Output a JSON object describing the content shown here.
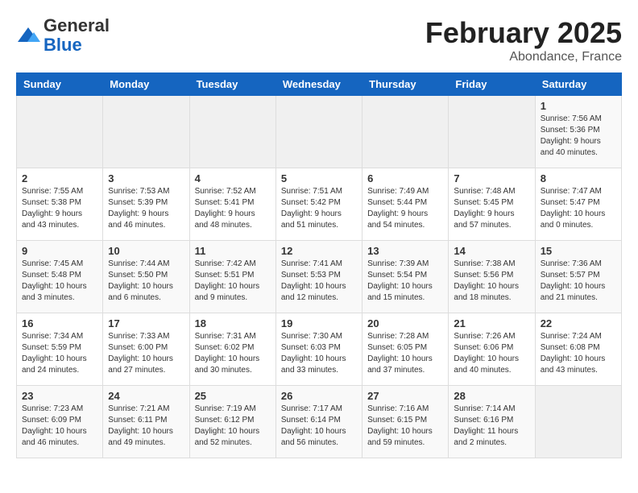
{
  "logo": {
    "general": "General",
    "blue": "Blue"
  },
  "title": "February 2025",
  "location": "Abondance, France",
  "days_of_week": [
    "Sunday",
    "Monday",
    "Tuesday",
    "Wednesday",
    "Thursday",
    "Friday",
    "Saturday"
  ],
  "weeks": [
    [
      {
        "day": "",
        "info": ""
      },
      {
        "day": "",
        "info": ""
      },
      {
        "day": "",
        "info": ""
      },
      {
        "day": "",
        "info": ""
      },
      {
        "day": "",
        "info": ""
      },
      {
        "day": "",
        "info": ""
      },
      {
        "day": "1",
        "info": "Sunrise: 7:56 AM\nSunset: 5:36 PM\nDaylight: 9 hours and 40 minutes."
      }
    ],
    [
      {
        "day": "2",
        "info": "Sunrise: 7:55 AM\nSunset: 5:38 PM\nDaylight: 9 hours and 43 minutes."
      },
      {
        "day": "3",
        "info": "Sunrise: 7:53 AM\nSunset: 5:39 PM\nDaylight: 9 hours and 46 minutes."
      },
      {
        "day": "4",
        "info": "Sunrise: 7:52 AM\nSunset: 5:41 PM\nDaylight: 9 hours and 48 minutes."
      },
      {
        "day": "5",
        "info": "Sunrise: 7:51 AM\nSunset: 5:42 PM\nDaylight: 9 hours and 51 minutes."
      },
      {
        "day": "6",
        "info": "Sunrise: 7:49 AM\nSunset: 5:44 PM\nDaylight: 9 hours and 54 minutes."
      },
      {
        "day": "7",
        "info": "Sunrise: 7:48 AM\nSunset: 5:45 PM\nDaylight: 9 hours and 57 minutes."
      },
      {
        "day": "8",
        "info": "Sunrise: 7:47 AM\nSunset: 5:47 PM\nDaylight: 10 hours and 0 minutes."
      }
    ],
    [
      {
        "day": "9",
        "info": "Sunrise: 7:45 AM\nSunset: 5:48 PM\nDaylight: 10 hours and 3 minutes."
      },
      {
        "day": "10",
        "info": "Sunrise: 7:44 AM\nSunset: 5:50 PM\nDaylight: 10 hours and 6 minutes."
      },
      {
        "day": "11",
        "info": "Sunrise: 7:42 AM\nSunset: 5:51 PM\nDaylight: 10 hours and 9 minutes."
      },
      {
        "day": "12",
        "info": "Sunrise: 7:41 AM\nSunset: 5:53 PM\nDaylight: 10 hours and 12 minutes."
      },
      {
        "day": "13",
        "info": "Sunrise: 7:39 AM\nSunset: 5:54 PM\nDaylight: 10 hours and 15 minutes."
      },
      {
        "day": "14",
        "info": "Sunrise: 7:38 AM\nSunset: 5:56 PM\nDaylight: 10 hours and 18 minutes."
      },
      {
        "day": "15",
        "info": "Sunrise: 7:36 AM\nSunset: 5:57 PM\nDaylight: 10 hours and 21 minutes."
      }
    ],
    [
      {
        "day": "16",
        "info": "Sunrise: 7:34 AM\nSunset: 5:59 PM\nDaylight: 10 hours and 24 minutes."
      },
      {
        "day": "17",
        "info": "Sunrise: 7:33 AM\nSunset: 6:00 PM\nDaylight: 10 hours and 27 minutes."
      },
      {
        "day": "18",
        "info": "Sunrise: 7:31 AM\nSunset: 6:02 PM\nDaylight: 10 hours and 30 minutes."
      },
      {
        "day": "19",
        "info": "Sunrise: 7:30 AM\nSunset: 6:03 PM\nDaylight: 10 hours and 33 minutes."
      },
      {
        "day": "20",
        "info": "Sunrise: 7:28 AM\nSunset: 6:05 PM\nDaylight: 10 hours and 37 minutes."
      },
      {
        "day": "21",
        "info": "Sunrise: 7:26 AM\nSunset: 6:06 PM\nDaylight: 10 hours and 40 minutes."
      },
      {
        "day": "22",
        "info": "Sunrise: 7:24 AM\nSunset: 6:08 PM\nDaylight: 10 hours and 43 minutes."
      }
    ],
    [
      {
        "day": "23",
        "info": "Sunrise: 7:23 AM\nSunset: 6:09 PM\nDaylight: 10 hours and 46 minutes."
      },
      {
        "day": "24",
        "info": "Sunrise: 7:21 AM\nSunset: 6:11 PM\nDaylight: 10 hours and 49 minutes."
      },
      {
        "day": "25",
        "info": "Sunrise: 7:19 AM\nSunset: 6:12 PM\nDaylight: 10 hours and 52 minutes."
      },
      {
        "day": "26",
        "info": "Sunrise: 7:17 AM\nSunset: 6:14 PM\nDaylight: 10 hours and 56 minutes."
      },
      {
        "day": "27",
        "info": "Sunrise: 7:16 AM\nSunset: 6:15 PM\nDaylight: 10 hours and 59 minutes."
      },
      {
        "day": "28",
        "info": "Sunrise: 7:14 AM\nSunset: 6:16 PM\nDaylight: 11 hours and 2 minutes."
      },
      {
        "day": "",
        "info": ""
      }
    ]
  ]
}
